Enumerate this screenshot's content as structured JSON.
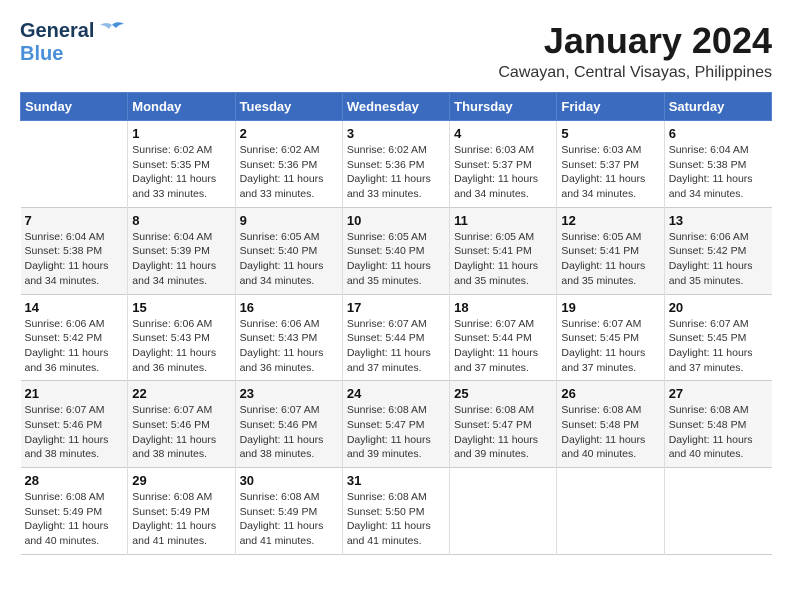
{
  "header": {
    "logo_general": "General",
    "logo_blue": "Blue",
    "month": "January 2024",
    "location": "Cawayan, Central Visayas, Philippines"
  },
  "calendar": {
    "days_of_week": [
      "Sunday",
      "Monday",
      "Tuesday",
      "Wednesday",
      "Thursday",
      "Friday",
      "Saturday"
    ],
    "weeks": [
      [
        {
          "day": "",
          "info": ""
        },
        {
          "day": "1",
          "info": "Sunrise: 6:02 AM\nSunset: 5:35 PM\nDaylight: 11 hours\nand 33 minutes."
        },
        {
          "day": "2",
          "info": "Sunrise: 6:02 AM\nSunset: 5:36 PM\nDaylight: 11 hours\nand 33 minutes."
        },
        {
          "day": "3",
          "info": "Sunrise: 6:02 AM\nSunset: 5:36 PM\nDaylight: 11 hours\nand 33 minutes."
        },
        {
          "day": "4",
          "info": "Sunrise: 6:03 AM\nSunset: 5:37 PM\nDaylight: 11 hours\nand 34 minutes."
        },
        {
          "day": "5",
          "info": "Sunrise: 6:03 AM\nSunset: 5:37 PM\nDaylight: 11 hours\nand 34 minutes."
        },
        {
          "day": "6",
          "info": "Sunrise: 6:04 AM\nSunset: 5:38 PM\nDaylight: 11 hours\nand 34 minutes."
        }
      ],
      [
        {
          "day": "7",
          "info": "Sunrise: 6:04 AM\nSunset: 5:38 PM\nDaylight: 11 hours\nand 34 minutes."
        },
        {
          "day": "8",
          "info": "Sunrise: 6:04 AM\nSunset: 5:39 PM\nDaylight: 11 hours\nand 34 minutes."
        },
        {
          "day": "9",
          "info": "Sunrise: 6:05 AM\nSunset: 5:40 PM\nDaylight: 11 hours\nand 34 minutes."
        },
        {
          "day": "10",
          "info": "Sunrise: 6:05 AM\nSunset: 5:40 PM\nDaylight: 11 hours\nand 35 minutes."
        },
        {
          "day": "11",
          "info": "Sunrise: 6:05 AM\nSunset: 5:41 PM\nDaylight: 11 hours\nand 35 minutes."
        },
        {
          "day": "12",
          "info": "Sunrise: 6:05 AM\nSunset: 5:41 PM\nDaylight: 11 hours\nand 35 minutes."
        },
        {
          "day": "13",
          "info": "Sunrise: 6:06 AM\nSunset: 5:42 PM\nDaylight: 11 hours\nand 35 minutes."
        }
      ],
      [
        {
          "day": "14",
          "info": "Sunrise: 6:06 AM\nSunset: 5:42 PM\nDaylight: 11 hours\nand 36 minutes."
        },
        {
          "day": "15",
          "info": "Sunrise: 6:06 AM\nSunset: 5:43 PM\nDaylight: 11 hours\nand 36 minutes."
        },
        {
          "day": "16",
          "info": "Sunrise: 6:06 AM\nSunset: 5:43 PM\nDaylight: 11 hours\nand 36 minutes."
        },
        {
          "day": "17",
          "info": "Sunrise: 6:07 AM\nSunset: 5:44 PM\nDaylight: 11 hours\nand 37 minutes."
        },
        {
          "day": "18",
          "info": "Sunrise: 6:07 AM\nSunset: 5:44 PM\nDaylight: 11 hours\nand 37 minutes."
        },
        {
          "day": "19",
          "info": "Sunrise: 6:07 AM\nSunset: 5:45 PM\nDaylight: 11 hours\nand 37 minutes."
        },
        {
          "day": "20",
          "info": "Sunrise: 6:07 AM\nSunset: 5:45 PM\nDaylight: 11 hours\nand 37 minutes."
        }
      ],
      [
        {
          "day": "21",
          "info": "Sunrise: 6:07 AM\nSunset: 5:46 PM\nDaylight: 11 hours\nand 38 minutes."
        },
        {
          "day": "22",
          "info": "Sunrise: 6:07 AM\nSunset: 5:46 PM\nDaylight: 11 hours\nand 38 minutes."
        },
        {
          "day": "23",
          "info": "Sunrise: 6:07 AM\nSunset: 5:46 PM\nDaylight: 11 hours\nand 38 minutes."
        },
        {
          "day": "24",
          "info": "Sunrise: 6:08 AM\nSunset: 5:47 PM\nDaylight: 11 hours\nand 39 minutes."
        },
        {
          "day": "25",
          "info": "Sunrise: 6:08 AM\nSunset: 5:47 PM\nDaylight: 11 hours\nand 39 minutes."
        },
        {
          "day": "26",
          "info": "Sunrise: 6:08 AM\nSunset: 5:48 PM\nDaylight: 11 hours\nand 40 minutes."
        },
        {
          "day": "27",
          "info": "Sunrise: 6:08 AM\nSunset: 5:48 PM\nDaylight: 11 hours\nand 40 minutes."
        }
      ],
      [
        {
          "day": "28",
          "info": "Sunrise: 6:08 AM\nSunset: 5:49 PM\nDaylight: 11 hours\nand 40 minutes."
        },
        {
          "day": "29",
          "info": "Sunrise: 6:08 AM\nSunset: 5:49 PM\nDaylight: 11 hours\nand 41 minutes."
        },
        {
          "day": "30",
          "info": "Sunrise: 6:08 AM\nSunset: 5:49 PM\nDaylight: 11 hours\nand 41 minutes."
        },
        {
          "day": "31",
          "info": "Sunrise: 6:08 AM\nSunset: 5:50 PM\nDaylight: 11 hours\nand 41 minutes."
        },
        {
          "day": "",
          "info": ""
        },
        {
          "day": "",
          "info": ""
        },
        {
          "day": "",
          "info": ""
        }
      ]
    ]
  }
}
